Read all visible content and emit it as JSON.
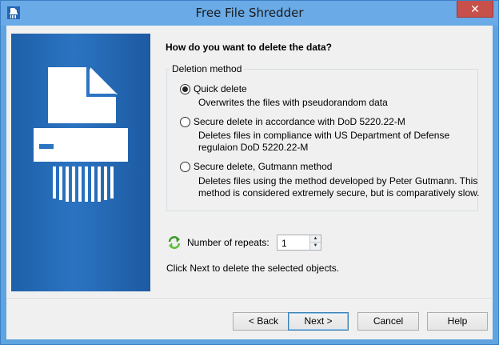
{
  "window": {
    "title": "Free File Shredder",
    "close_glyph": "✕"
  },
  "page": {
    "heading": "How do you want to delete the data?",
    "group_label": "Deletion method",
    "options": [
      {
        "label": "Quick delete",
        "checked": true,
        "description": [
          "Overwrites the files with pseudorandom data"
        ]
      },
      {
        "label": "Secure delete in accordance with DoD 5220.22-M",
        "checked": false,
        "description": [
          "Deletes files in compliance with US Department of Defense",
          "regulaion DoD 5220.22-M"
        ]
      },
      {
        "label": "Secure delete, Gutmann method",
        "checked": false,
        "description": [
          "Deletes files using the method developed by Peter Gutmann. This",
          "method is considered extremely secure, but is comparatively slow."
        ]
      }
    ],
    "repeats_label": "Number of repeats:",
    "repeats_value": "1",
    "hint": "Click Next to delete the selected objects."
  },
  "buttons": {
    "back": "< Back",
    "next": "Next >",
    "cancel": "Cancel",
    "help": "Help"
  },
  "icons": {
    "app": "shredder-icon",
    "repeat": "repeat-arrows-icon",
    "banner": "shredder-illustration"
  },
  "colors": {
    "title_bar": "#6aaae6",
    "banner": "#2b74c2",
    "close_button": "#c7504a"
  }
}
